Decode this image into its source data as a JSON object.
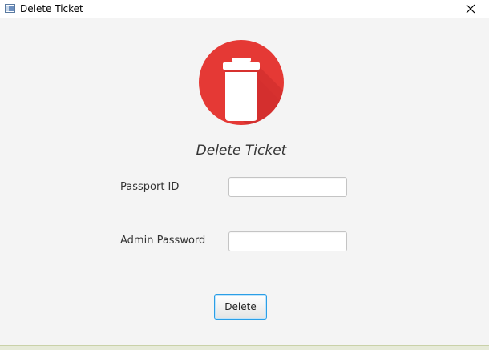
{
  "window": {
    "title": "Delete Ticket",
    "icon": "java-app-icon",
    "close_icon": "close-icon"
  },
  "form": {
    "heading": "Delete Ticket",
    "icon": "trash-icon",
    "icon_color": "#e53935",
    "passport_label": "Passport ID",
    "passport_value": "",
    "admin_password_label": "Admin Password",
    "admin_password_value": "",
    "delete_button_label": "Delete"
  },
  "colors": {
    "accent_border": "#2a9ee6",
    "background": "#f4f4f4"
  }
}
